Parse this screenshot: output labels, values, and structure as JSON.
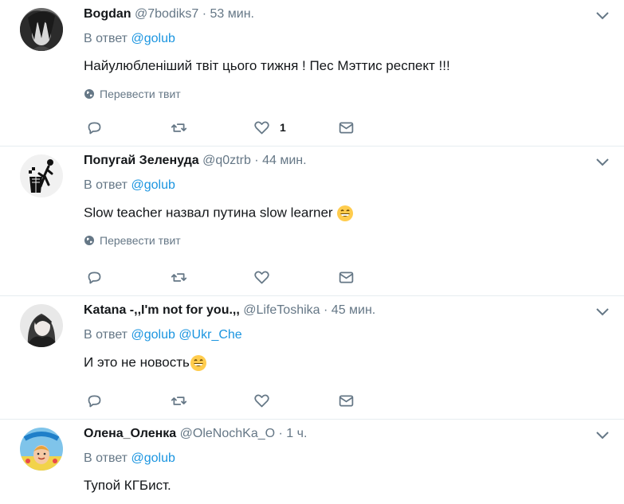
{
  "tweets": [
    {
      "name": "Bogdan",
      "handle": "@7bodiks7",
      "time": "· 53 мин.",
      "reply_prefix": "В ответ",
      "reply_to": [
        "@golub"
      ],
      "text": "Найулюбленіший  твіт цього тижня !  Пес Мэттис респект !!!",
      "translate": "Перевести твит",
      "like_count": "1"
    },
    {
      "name": "Попугай Зеленуда",
      "handle": "@q0ztrb",
      "time": "· 44 мин.",
      "reply_prefix": "В ответ",
      "reply_to": [
        "@golub"
      ],
      "text": "Slow teacher назвал путина slow learner",
      "translate": "Перевести твит",
      "like_count": ""
    },
    {
      "name": "Katana -,,I'm not for you.,,",
      "handle": "@LifeToshika",
      "time": "· 45 мин.",
      "reply_prefix": "В ответ",
      "reply_to": [
        "@golub",
        "@Ukr_Che"
      ],
      "text": "И это не новость",
      "translate": "",
      "like_count": ""
    },
    {
      "name": "Олена_Оленка",
      "handle": "@OleNochKa_O",
      "time": "· 1 ч.",
      "reply_prefix": "В ответ",
      "reply_to": [
        "@golub"
      ],
      "text": "Тупой КГБист.",
      "translate": "",
      "like_count": ""
    }
  ],
  "icons": {
    "reply": "reply-icon",
    "retweet": "retweet-icon",
    "like": "heart-icon",
    "dm": "envelope-icon",
    "translate": "globe-icon",
    "menu": "chevron-down-icon",
    "emoji": "grinning-emoji-icon"
  },
  "colors": {
    "link": "#1b95e0",
    "secondary": "#657786",
    "divider": "#e6ecf0"
  }
}
